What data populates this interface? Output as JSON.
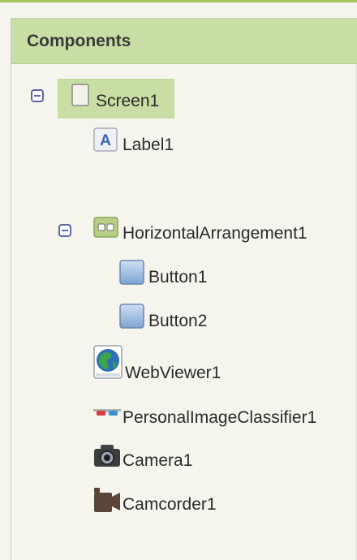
{
  "panel": {
    "title": "Components"
  },
  "tree": {
    "screen": {
      "label": "Screen1",
      "icon": "screen-icon",
      "expanded": true,
      "selected": true
    },
    "label1": {
      "label": "Label1",
      "icon": "label-a-icon"
    },
    "horizontal": {
      "label": "HorizontalArrangement1",
      "icon": "horizontal-arrangement-icon",
      "expanded": true
    },
    "button1": {
      "label": "Button1",
      "icon": "button-icon"
    },
    "button2": {
      "label": "Button2",
      "icon": "button-icon"
    },
    "webviewer": {
      "label": "WebViewer1",
      "icon": "globe-icon"
    },
    "classifier": {
      "label": "PersonalImageClassifier1",
      "icon": "glasses-icon"
    },
    "camera": {
      "label": "Camera1",
      "icon": "camera-icon"
    },
    "camcorder": {
      "label": "Camcorder1",
      "icon": "camcorder-icon"
    }
  },
  "colors": {
    "accent": "#a5c45a",
    "header": "#c9dea4",
    "toggle": "#5a67a8",
    "background": "#f5f5ee"
  }
}
